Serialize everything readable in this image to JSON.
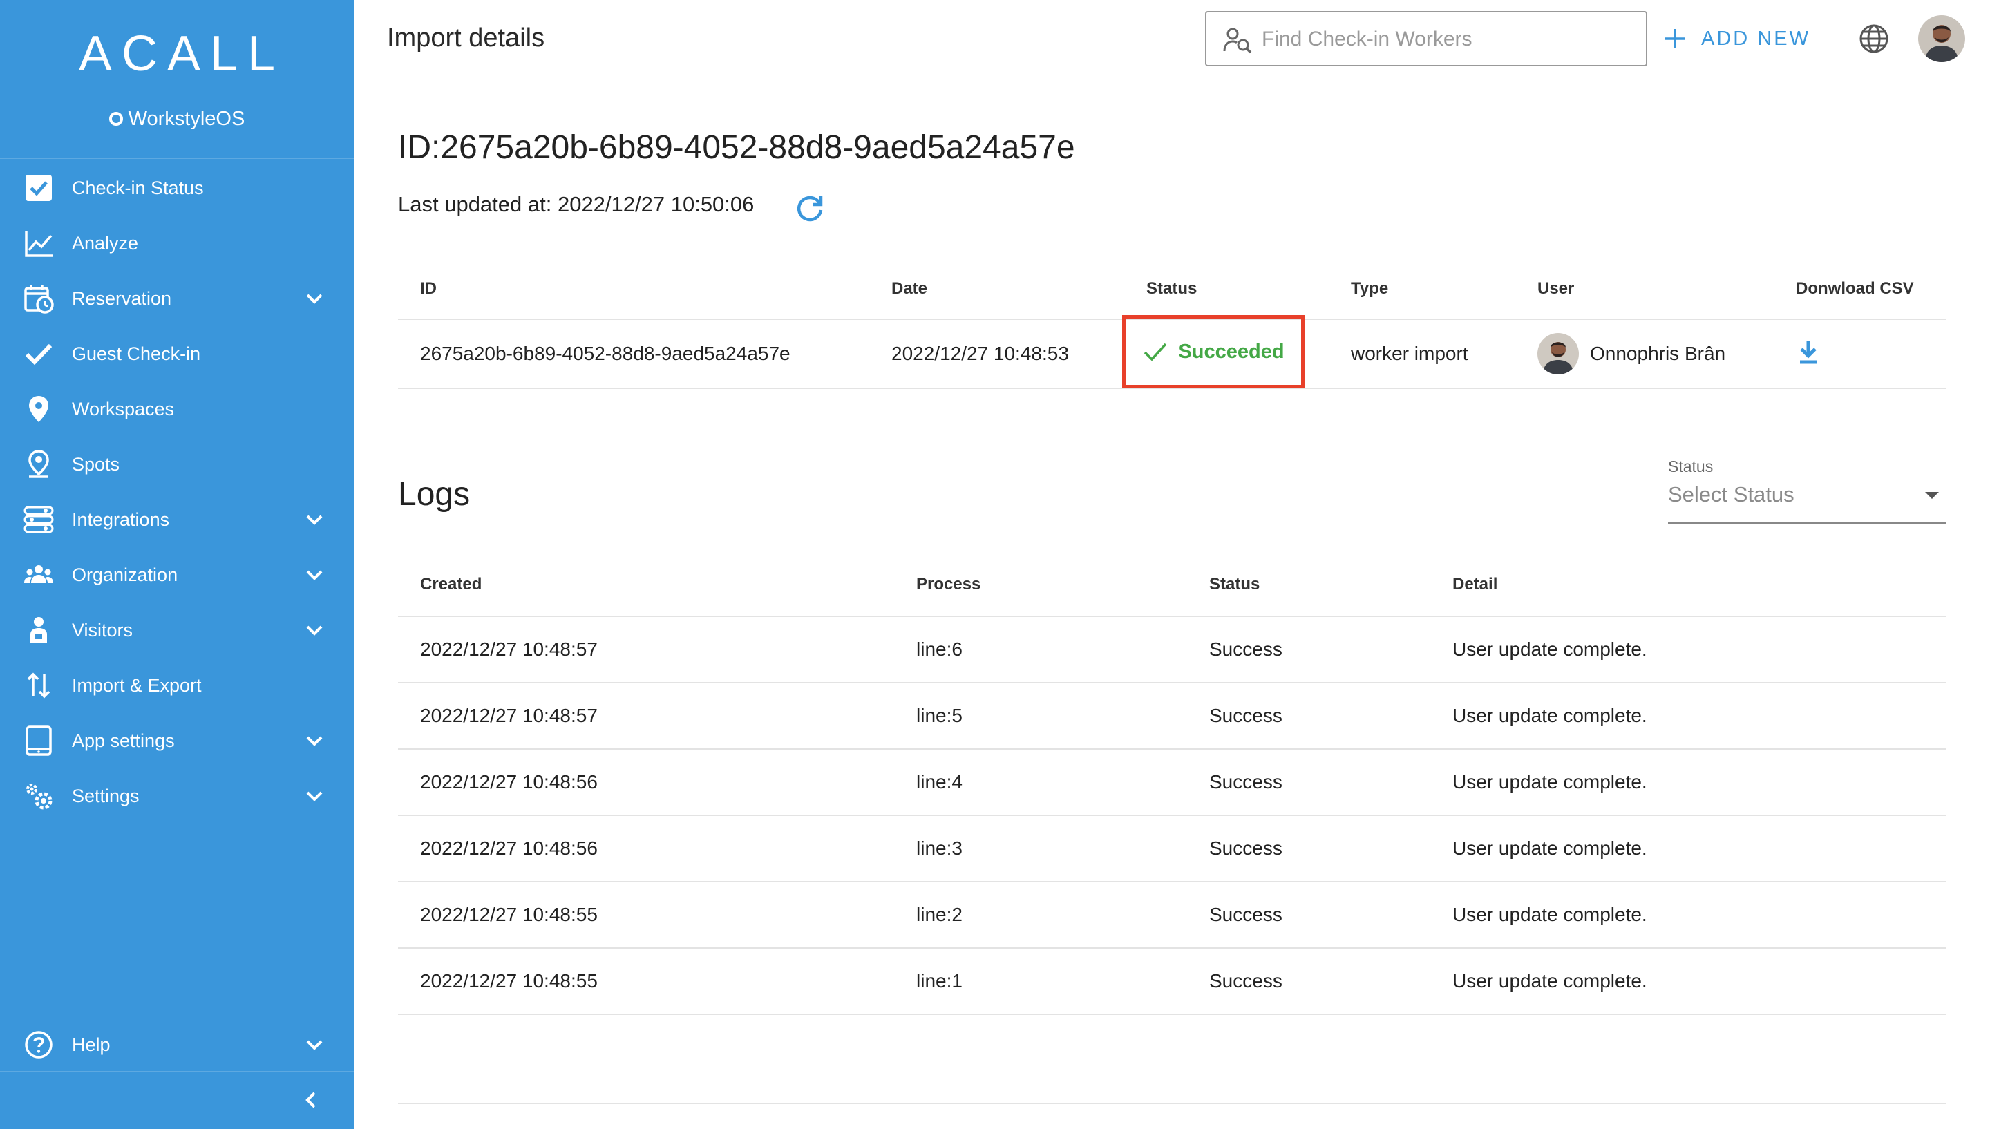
{
  "brand": {
    "logo": "ACALL",
    "sub": "WorkstyleOS"
  },
  "sidebar": {
    "items": [
      {
        "label": "Check-in Status",
        "icon": "checkbox-icon",
        "chevron": false
      },
      {
        "label": "Analyze",
        "icon": "chart-line-icon",
        "chevron": false
      },
      {
        "label": "Reservation",
        "icon": "calendar-clock-icon",
        "chevron": true
      },
      {
        "label": "Guest Check-in",
        "icon": "checkmark-icon",
        "chevron": false
      },
      {
        "label": "Workspaces",
        "icon": "map-pin-icon",
        "chevron": false
      },
      {
        "label": "Spots",
        "icon": "person-pin-icon",
        "chevron": false
      },
      {
        "label": "Integrations",
        "icon": "integration-icon",
        "chevron": true
      },
      {
        "label": "Organization",
        "icon": "group-icon",
        "chevron": true
      },
      {
        "label": "Visitors",
        "icon": "visitor-icon",
        "chevron": true
      },
      {
        "label": "Import & Export",
        "icon": "import-export-icon",
        "chevron": false
      },
      {
        "label": "App settings",
        "icon": "tablet-icon",
        "chevron": true
      },
      {
        "label": "Settings",
        "icon": "gears-icon",
        "chevron": true
      }
    ],
    "help": {
      "label": "Help",
      "icon": "help-circle-icon"
    }
  },
  "header": {
    "title": "Import details",
    "search_placeholder": "Find Check-in Workers",
    "add_new": "ADD NEW"
  },
  "import": {
    "id_line": "ID:2675a20b-6b89-4052-88d8-9aed5a24a57e",
    "last_updated": "Last updated at: 2022/12/27 10:50:06",
    "columns": [
      "ID",
      "Date",
      "Status",
      "Type",
      "User",
      "Donwload CSV"
    ],
    "row": {
      "id": "2675a20b-6b89-4052-88d8-9aed5a24a57e",
      "date": "2022/12/27 10:48:53",
      "status": "Succeeded",
      "type": "worker import",
      "user": "Onnophris Brân"
    }
  },
  "logs": {
    "title": "Logs",
    "filter_caption": "Status",
    "filter_value": "Select Status",
    "columns": [
      "Created",
      "Process",
      "Status",
      "Detail"
    ],
    "rows": [
      {
        "created": "2022/12/27 10:48:57",
        "process": "line:6",
        "status": "Success",
        "detail": "User update complete."
      },
      {
        "created": "2022/12/27 10:48:57",
        "process": "line:5",
        "status": "Success",
        "detail": "User update complete."
      },
      {
        "created": "2022/12/27 10:48:56",
        "process": "line:4",
        "status": "Success",
        "detail": "User update complete."
      },
      {
        "created": "2022/12/27 10:48:56",
        "process": "line:3",
        "status": "Success",
        "detail": "User update complete."
      },
      {
        "created": "2022/12/27 10:48:55",
        "process": "line:2",
        "status": "Success",
        "detail": "User update complete."
      },
      {
        "created": "2022/12/27 10:48:55",
        "process": "line:1",
        "status": "Success",
        "detail": "User update complete."
      }
    ]
  },
  "colors": {
    "sidebar": "#3a96db",
    "accent": "#3a96db",
    "success": "#44a846",
    "highlight": "#e8402a"
  }
}
